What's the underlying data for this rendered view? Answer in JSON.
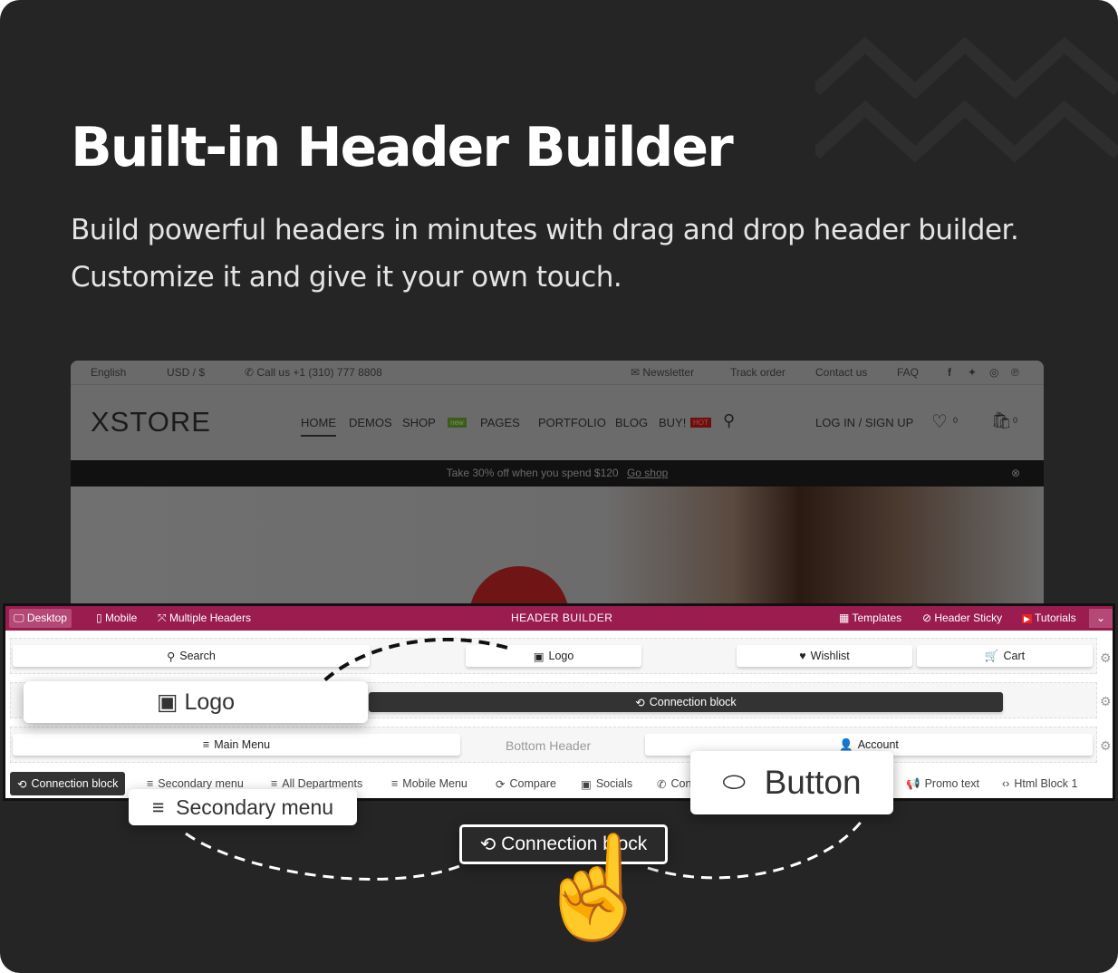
{
  "hero": {
    "title": "Built-in Header Builder",
    "line1": "Build powerful headers in minutes with drag and drop header builder.",
    "line2": "Customize it and give it your own touch."
  },
  "site": {
    "topbar": {
      "language": "English",
      "currency": "USD / $",
      "phone": "Call us +1 (310) 777 8808",
      "links": [
        "Newsletter",
        "Track order",
        "Contact us",
        "FAQ"
      ]
    },
    "logo": "XSTORE",
    "nav": [
      "HOME",
      "DEMOS",
      "SHOP",
      "PAGES",
      "PORTFOLIO",
      "BLOG",
      "BUY!"
    ],
    "badges": {
      "new": "new",
      "hot": "HOT"
    },
    "login": "LOG IN / SIGN UP",
    "wishlist_count": "0",
    "cart_count": "0",
    "promo": "Take 30% off when you spend $120",
    "promo_link": "Go shop"
  },
  "builder": {
    "accent": "#9b1d50",
    "left_tabs": [
      "Desktop",
      "Mobile",
      "Multiple Headers"
    ],
    "title": "HEADER BUILDER",
    "right_tabs": [
      "Templates",
      "Header Sticky",
      "Tutorials"
    ],
    "row1": [
      "Search",
      "Logo",
      "Wishlist",
      "Cart"
    ],
    "row2": [
      "Connection block"
    ],
    "row3": {
      "left": "Main Menu",
      "placeholder": "Bottom Header",
      "right": "Account"
    },
    "elements": [
      "Connection block",
      "Secondary menu",
      "All Departments",
      "Mobile Menu",
      "Compare",
      "Socials",
      "Con",
      "Promo text",
      "Html Block 1"
    ],
    "floating": {
      "logo": "Logo",
      "secondary": "Secondary menu",
      "button": "Button",
      "connection": "Connection block"
    }
  }
}
